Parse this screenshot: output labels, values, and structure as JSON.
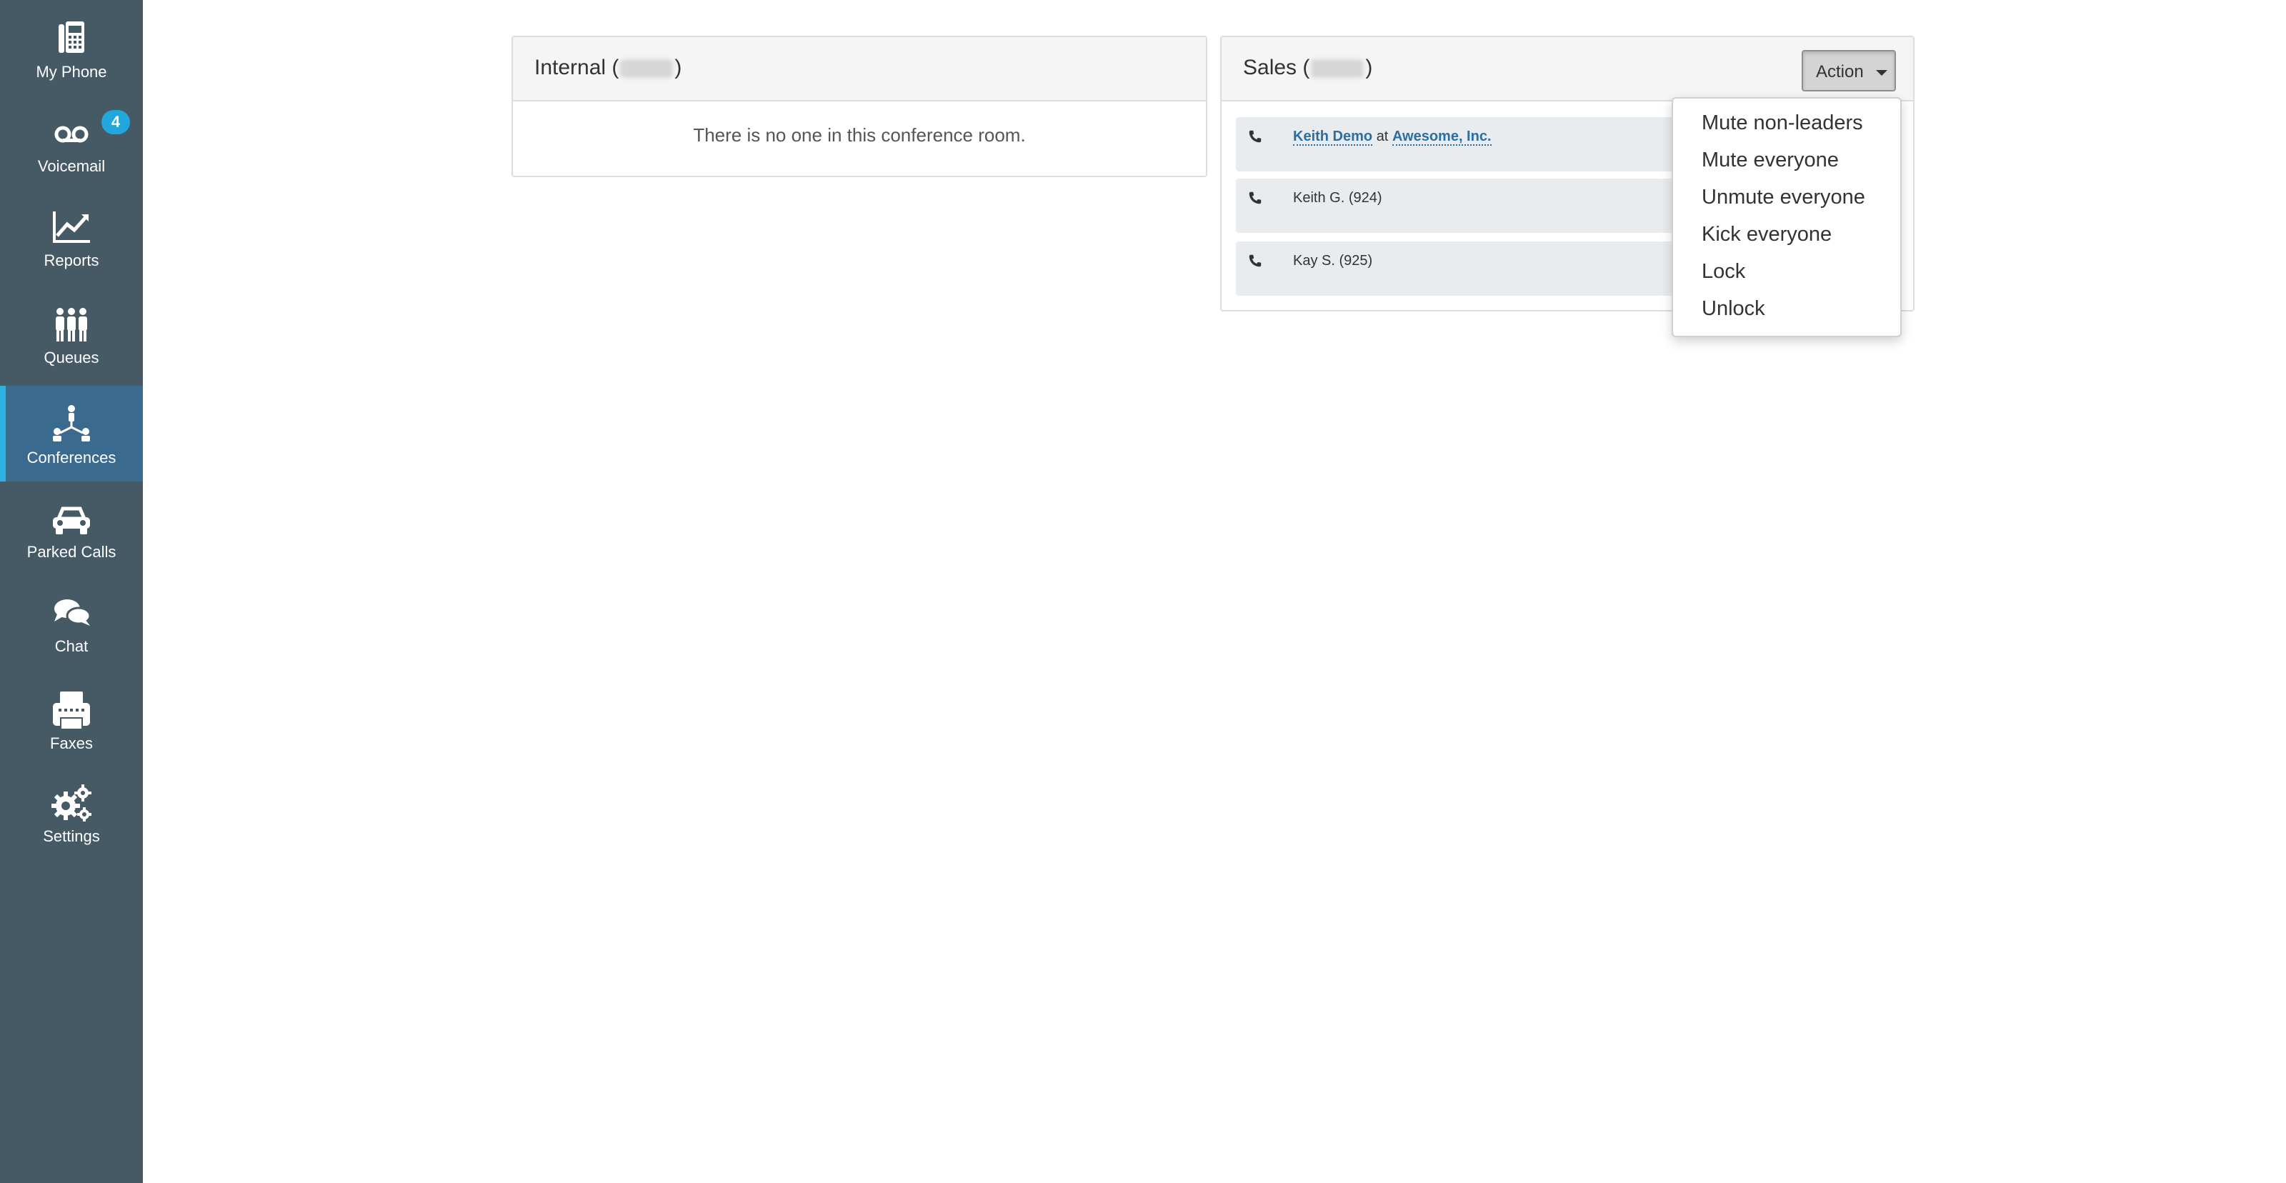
{
  "sidebar": {
    "items": [
      {
        "label": "My Phone",
        "icon": "desk-phone-icon"
      },
      {
        "label": "Voicemail",
        "icon": "voicemail-icon",
        "badge": "4"
      },
      {
        "label": "Reports",
        "icon": "line-chart-icon"
      },
      {
        "label": "Queues",
        "icon": "people-queue-icon"
      },
      {
        "label": "Conferences",
        "icon": "conference-network-icon",
        "active": true
      },
      {
        "label": "Parked Calls",
        "icon": "car-icon"
      },
      {
        "label": "Chat",
        "icon": "chat-bubbles-icon"
      },
      {
        "label": "Faxes",
        "icon": "fax-icon"
      },
      {
        "label": "Settings",
        "icon": "gears-icon"
      }
    ]
  },
  "conferences": [
    {
      "title": "Internal",
      "empty_message": "There is no one in this conference room."
    },
    {
      "title": "Sales",
      "action_label": "Action",
      "participants": [
        {
          "name": "Keith Demo",
          "at": "at",
          "company": "Awesome, Inc."
        },
        {
          "name": "Keith G. (924)"
        },
        {
          "name": "Kay S. (925)"
        }
      ]
    }
  ],
  "action_menu": {
    "items": [
      "Mute non-leaders",
      "Mute everyone",
      "Unmute everyone",
      "Kick everyone",
      "Lock",
      "Unlock"
    ]
  },
  "colors": {
    "sidebar_bg": "#465a66",
    "active_item_bg": "#3a6a8e",
    "accent": "#2fb1e3",
    "link": "#2a6ea6"
  }
}
